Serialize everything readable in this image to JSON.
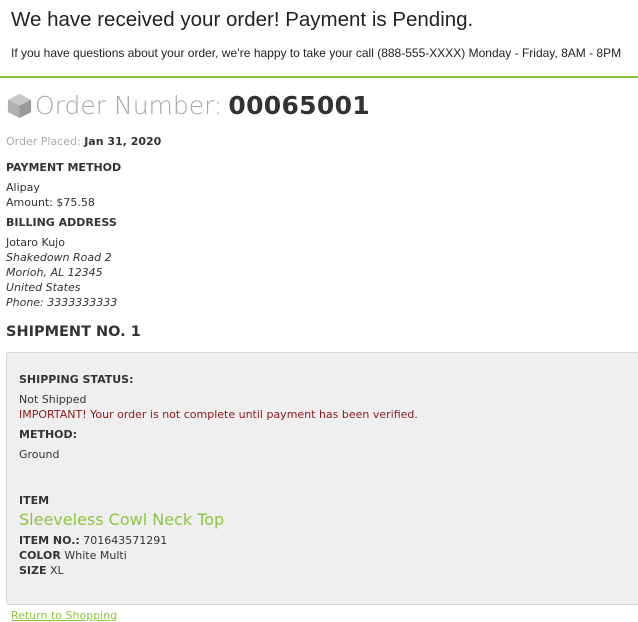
{
  "banner": {
    "title": "We have received your order! Payment is Pending.",
    "subtitle": "If you have questions about your order, we’re happy to take your call (888-555-XXXX) Monday - Friday, 8AM - 8PM"
  },
  "order": {
    "label": "Order Number:",
    "number": "00065001",
    "placed_label": "Order Placed:",
    "placed_date": "Jan 31, 2020"
  },
  "payment": {
    "heading": "PAYMENT METHOD",
    "method": "Alipay",
    "amount": "Amount: $75.58"
  },
  "billing": {
    "heading": "BILLING ADDRESS",
    "name": "Jotaro Kujo",
    "street": "Shakedown Road 2",
    "city": "Morioh, AL 12345",
    "country": "United States",
    "phone": "Phone: 3333333333"
  },
  "shipment": {
    "title": "SHIPMENT NO. 1",
    "status_heading": "SHIPPING STATUS:",
    "status": "Not Shipped",
    "warning": "IMPORTANT! Your order is not complete until payment has been verified.",
    "method_heading": "METHOD:",
    "method": "Ground",
    "item_heading": "ITEM",
    "item_name": "Sleeveless Cowl Neck Top",
    "item_no_label": "ITEM NO.:",
    "item_no": "701643571291",
    "color_label": "COLOR",
    "color": "White Multi",
    "size_label": "SIZE",
    "size": "XL"
  },
  "footer": {
    "return_link": "Return to Shopping"
  },
  "colors": {
    "accent": "#8cc63f",
    "warning": "#8b1a1a",
    "panel_bg": "#efefef"
  },
  "icons": {
    "order": "box-icon"
  }
}
